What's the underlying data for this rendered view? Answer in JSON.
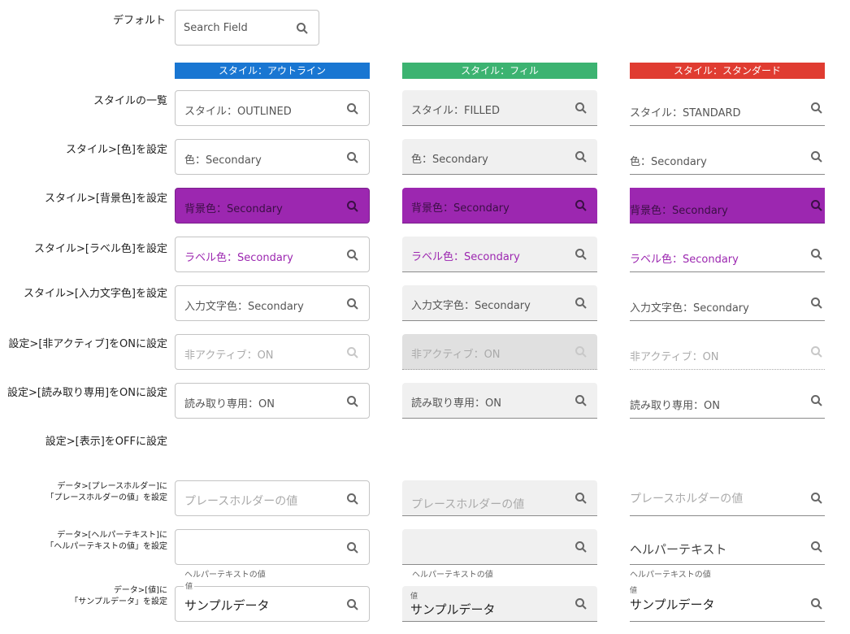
{
  "default": {
    "label": "デフォルト",
    "placeholder": "Search Field"
  },
  "columns": {
    "outlined": {
      "title": "スタイル：アウトライン",
      "color": "#1976d2"
    },
    "filled": {
      "title": "スタイル：フィル",
      "color": "#3cb371"
    },
    "standard": {
      "title": "スタイル：スタンダード",
      "color": "#e03c31"
    }
  },
  "rows": {
    "style_list": {
      "label": "スタイルの一覧",
      "outlined": "スタイル：OUTLINED",
      "filled": "スタイル：FILLED",
      "standard": "スタイル：STANDARD"
    },
    "color": {
      "label": "スタイル>[色]を設定",
      "value": "色：Secondary"
    },
    "bg_color": {
      "label": "スタイル>[背景色]を設定",
      "value": "背景色：Secondary"
    },
    "label_color": {
      "label": "スタイル>[ラベル色]を設定",
      "value": "ラベル色：Secondary"
    },
    "input_color": {
      "label": "スタイル>[入力文字色]を設定",
      "value": "入力文字色：Secondary"
    },
    "inactive": {
      "label": "設定>[非アクティブ]をONに設定",
      "value": "非アクティブ：ON"
    },
    "readonly": {
      "label": "設定>[読み取り専用]をONに設定",
      "value": "読み取り専用：ON"
    },
    "display": {
      "label": "設定>[表示]をOFFに設定"
    },
    "placeholder": {
      "label1": "データ>[プレースホルダー]に",
      "label2": "「プレースホルダーの値」を設定",
      "value": "プレースホルダーの値"
    },
    "helper": {
      "label1": "データ>[ヘルパーテキスト]に",
      "label2": "「ヘルパーテキストの値」を設定",
      "value": "ヘルパーテキストの値",
      "standard_value": "ヘルパーテキスト"
    },
    "value": {
      "label1": "データ>[値]に",
      "label2": "「サンプルデータ」を設定",
      "mini": "値",
      "value": "サンプルデータ"
    }
  },
  "colors": {
    "secondary": "#9c27b0"
  },
  "icons": {
    "search": "search-icon"
  }
}
